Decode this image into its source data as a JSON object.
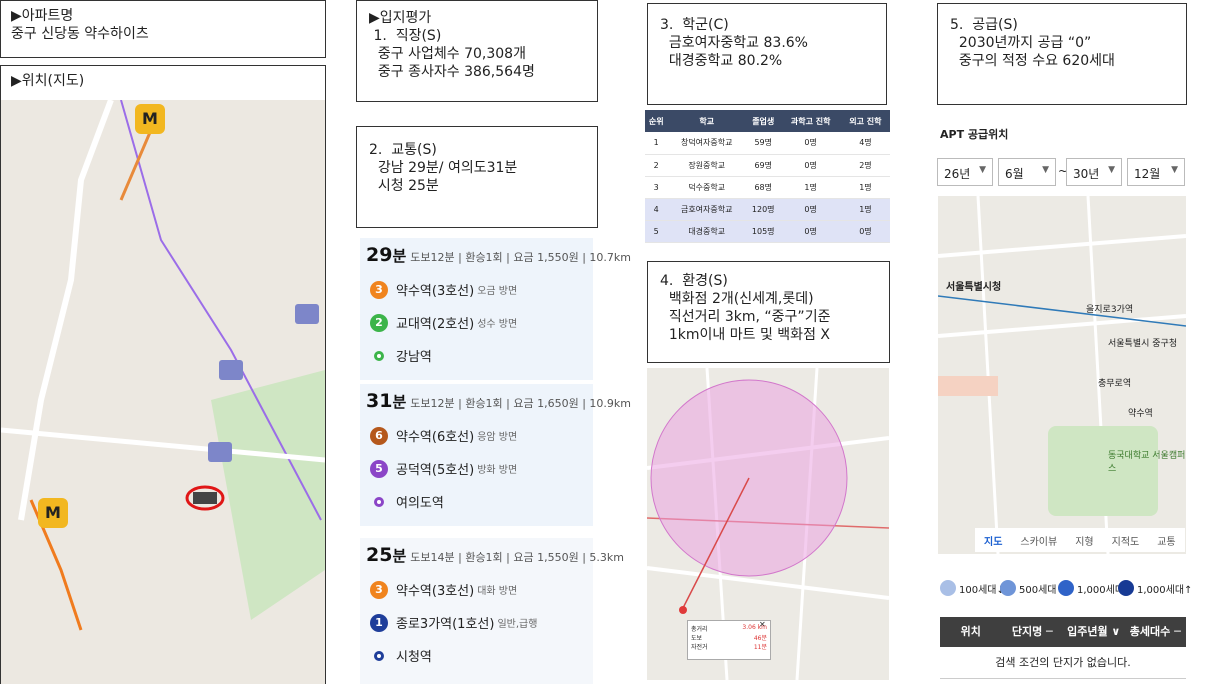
{
  "apt_name_box": {
    "heading": "▶아파트명",
    "value": "중구 신당동 약수하이츠"
  },
  "location_box": {
    "heading": "▶위치(지도)"
  },
  "site_eval_box": {
    "lines": [
      "▶입지평가",
      " 1.  직장(S)",
      "  중구 사업체수 70,308개",
      "  중구 종사자수 386,564명"
    ]
  },
  "transport_box": {
    "lines": [
      "2.  교통(S)",
      "  강남 29분/ 여의도31분",
      "  시청 25분"
    ]
  },
  "routes": [
    {
      "time": "29",
      "unit": "분",
      "meta": "도보12분 | 환승1회 | 요금 1,550원 | 10.7km",
      "steps": [
        {
          "badge": "3",
          "color": "#f0841e",
          "station": "약수역(3호선)",
          "direction": "오금 방면"
        },
        {
          "badge": "2",
          "color": "#3cb44a",
          "station": "교대역(2호선)",
          "direction": "성수 방면"
        },
        {
          "badge": "",
          "color": "#3cb44a",
          "station": "강남역",
          "direction": ""
        }
      ]
    },
    {
      "time": "31",
      "unit": "분",
      "meta": "도보12분 | 환승1회 | 요금 1,650원 | 10.9km",
      "steps": [
        {
          "badge": "6",
          "color": "#b5581c",
          "station": "약수역(6호선)",
          "direction": "응암 방면"
        },
        {
          "badge": "5",
          "color": "#8b45c7",
          "station": "공덕역(5호선)",
          "direction": "방화 방면"
        },
        {
          "badge": "",
          "color": "#8b45c7",
          "station": "여의도역",
          "direction": ""
        }
      ]
    },
    {
      "time": "25",
      "unit": "분",
      "meta": "도보14분 | 환승1회 | 요금 1,550원 | 5.3km",
      "steps": [
        {
          "badge": "3",
          "color": "#f0841e",
          "station": "약수역(3호선)",
          "direction": "대화 방면"
        },
        {
          "badge": "1",
          "color": "#1f3e9a",
          "station": "종로3가역(1호선)",
          "direction": "일반,급행"
        },
        {
          "badge": "",
          "color": "#1f3e9a",
          "station": "시청역",
          "direction": ""
        }
      ]
    }
  ],
  "school_box": {
    "lines": [
      "3.  학군(C)",
      "  금호여자중학교 83.6%",
      "  대경중학교 80.2%"
    ]
  },
  "school_table": {
    "headers": [
      "순위",
      "학교",
      "졸업생",
      "과학고 진학",
      "외고 진학"
    ],
    "rows": [
      [
        "1",
        "창덕여자중학교",
        "59명",
        "0명",
        "4명"
      ],
      [
        "2",
        "장원중학교",
        "69명",
        "0명",
        "2명"
      ],
      [
        "3",
        "덕수중학교",
        "68명",
        "1명",
        "1명"
      ],
      [
        "4",
        "금호여자중학교",
        "120명",
        "0명",
        "1명"
      ],
      [
        "5",
        "대경중학교",
        "105명",
        "0명",
        "0명"
      ]
    ],
    "highlight_rows": [
      3,
      4
    ]
  },
  "env_box": {
    "lines": [
      "4.  환경(S)",
      "  백화점 2개(신세계,롯데)",
      "  직선거리 3km, “중구”기준",
      "  1km이내 마트 및 백화점 X"
    ]
  },
  "env_map_popup": {
    "rows": [
      [
        "총거리",
        "3.06 km"
      ],
      [
        "도보",
        "46분"
      ],
      [
        "자전거",
        "11분"
      ]
    ]
  },
  "supply_box": {
    "lines": [
      "5.  공급(S)",
      "  2030년까지 공급 “0”",
      "  중구의 적정 수요 620세대"
    ]
  },
  "apt_supply": {
    "title": "APT 공급위치",
    "selects": [
      "26년",
      "6월",
      "30년",
      "12월"
    ],
    "range_sep": "~",
    "map_labels": [
      "서울특별시청",
      "을지로3가역",
      "충무로역",
      "서울특별시 중구청",
      "약수역",
      "동국대학교 서울캠퍼스"
    ],
    "map_tabs": [
      "지도",
      "스카이뷰",
      "지형",
      "지적도",
      "교통"
    ],
    "active_tab": "지도",
    "legend": [
      {
        "label": "100세대↓",
        "color": "#a9bfe6"
      },
      {
        "label": "500세대↓",
        "color": "#6f95d8"
      },
      {
        "label": "1,000세대↓",
        "color": "#2f63c8"
      },
      {
        "label": "1,000세대↑",
        "color": "#173a94"
      }
    ],
    "table_headers": [
      "위치",
      "단지명 ─",
      "입주년월 ∨",
      "총세대수 ─"
    ],
    "empty_message": "검색 조건의 단지가 없습니다."
  }
}
